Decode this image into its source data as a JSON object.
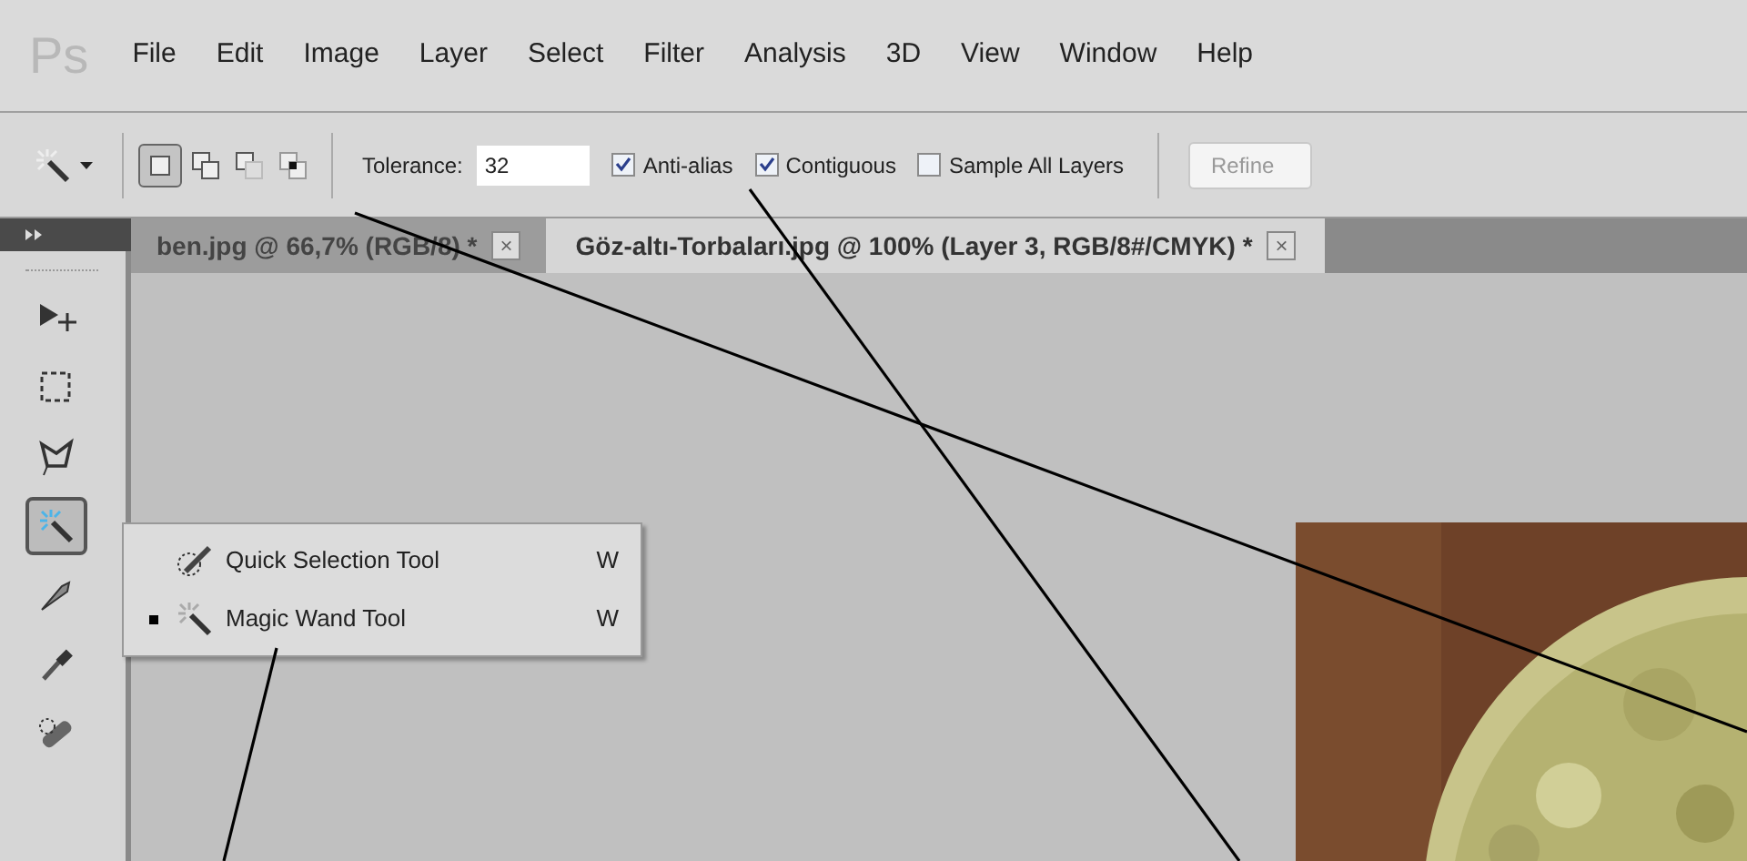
{
  "app_logo": "Ps",
  "menu": [
    "File",
    "Edit",
    "Image",
    "Layer",
    "Select",
    "Filter",
    "Analysis",
    "3D",
    "View",
    "Window",
    "Help"
  ],
  "options_bar": {
    "mode_buttons": [
      {
        "kind": "new",
        "selected": true
      },
      {
        "kind": "add",
        "selected": false
      },
      {
        "kind": "subtract",
        "selected": false
      },
      {
        "kind": "intersect",
        "selected": false
      }
    ],
    "tolerance_label": "Tolerance:",
    "tolerance_value": "32",
    "checkboxes": [
      {
        "label": "Anti-alias",
        "checked": true
      },
      {
        "label": "Contiguous",
        "checked": true
      },
      {
        "label": "Sample All Layers",
        "checked": false
      }
    ],
    "refine_button": "Refine"
  },
  "tabs": [
    {
      "label": "ben.jpg @ 66,7% (RGB/8) *",
      "close": "×",
      "selected": false
    },
    {
      "label": "Göz-altı-Torbaları.jpg @ 100% (Layer 3, RGB/8#/CMYK) *",
      "close": "×",
      "selected": true
    }
  ],
  "tools": [
    {
      "kind": "move",
      "selected": false
    },
    {
      "kind": "marquee",
      "selected": false
    },
    {
      "kind": "lasso",
      "selected": false
    },
    {
      "kind": "wand",
      "selected": true
    },
    {
      "kind": "brush",
      "selected": false
    },
    {
      "kind": "eyedropper",
      "selected": false
    },
    {
      "kind": "healing",
      "selected": false
    }
  ],
  "flyout": [
    {
      "label": "Quick Selection Tool",
      "shortcut": "W",
      "kind": "quick",
      "selected": false
    },
    {
      "label": "Magic Wand Tool",
      "shortcut": "W",
      "kind": "wand",
      "selected": true
    }
  ]
}
